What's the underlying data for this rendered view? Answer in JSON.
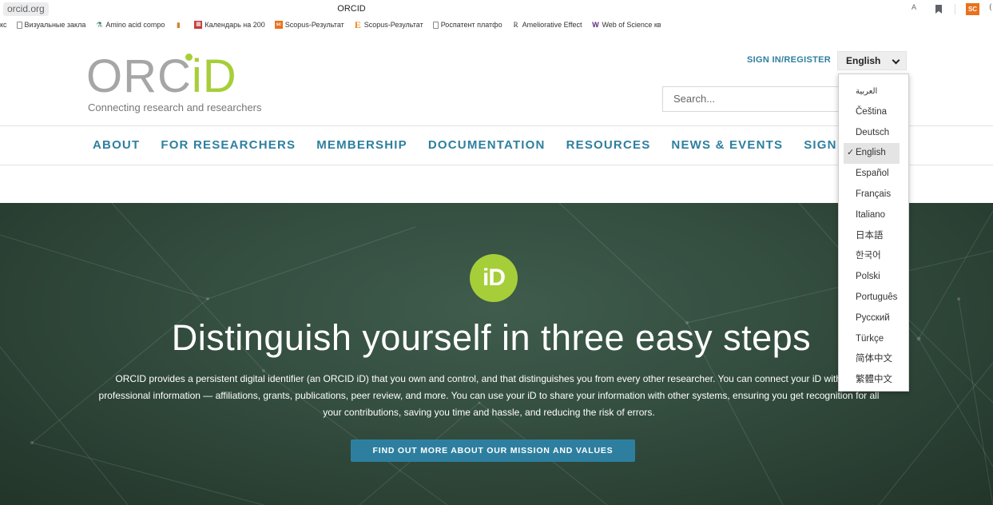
{
  "browser": {
    "url": "orcid.org",
    "window_title": "ORCID",
    "translate_icon_text": "A",
    "extension_label": "SC",
    "bookmarks": [
      {
        "label": "кс",
        "icon": "none"
      },
      {
        "label": "Визуальные закла",
        "icon": "page-icon"
      },
      {
        "label": "Amino acid compo",
        "icon": "amino-icon"
      },
      {
        "label": "",
        "icon": "books-icon"
      },
      {
        "label": "Календарь на 200",
        "icon": "calendar-icon"
      },
      {
        "label": "Scopus-Результат",
        "icon": "scopus-icon"
      },
      {
        "label": "Scopus-Результат",
        "icon": "e-icon"
      },
      {
        "label": "Роспатент платфо",
        "icon": "page-icon"
      },
      {
        "label": "Ameliorative Effect",
        "icon": "r-icon"
      },
      {
        "label": "Web of Science кв",
        "icon": "wos-icon"
      }
    ]
  },
  "header": {
    "logo_orc": "ORC",
    "logo_id": "iD",
    "tagline": "Connecting research and researchers",
    "sign_in_register": "SIGN IN/REGISTER",
    "language_current": "English",
    "search_placeholder": "Search..."
  },
  "nav": [
    "ABOUT",
    "FOR RESEARCHERS",
    "MEMBERSHIP",
    "DOCUMENTATION",
    "RESOURCES",
    "NEWS & EVENTS",
    "SIGN IN"
  ],
  "hero": {
    "badge": "iD",
    "title": "Distinguish yourself in three easy steps",
    "text": "ORCID provides a persistent digital identifier (an ORCID iD) that you own and control, and that distinguishes you from every other researcher. You can connect your iD with your professional information — affiliations, grants, publications, peer review, and more. You can use your iD to share your information with other systems, ensuring you get recognition for all your contributions, saving you time and hassle, and reducing the risk of errors.",
    "button": "FIND OUT MORE ABOUT OUR MISSION AND VALUES"
  },
  "language_menu": {
    "selected": "English",
    "check_mark": "✓",
    "options": [
      "العربية",
      "Čeština",
      "Deutsch",
      "English",
      "Español",
      "Français",
      "Italiano",
      "日本語",
      "한국어",
      "Polski",
      "Português",
      "Русский",
      "Türkçe",
      "简体中文",
      "繁體中文"
    ]
  },
  "colors": {
    "orcid_green": "#a6ce39",
    "link_blue": "#2e7f9f",
    "hero_dark": "#2b4436"
  }
}
